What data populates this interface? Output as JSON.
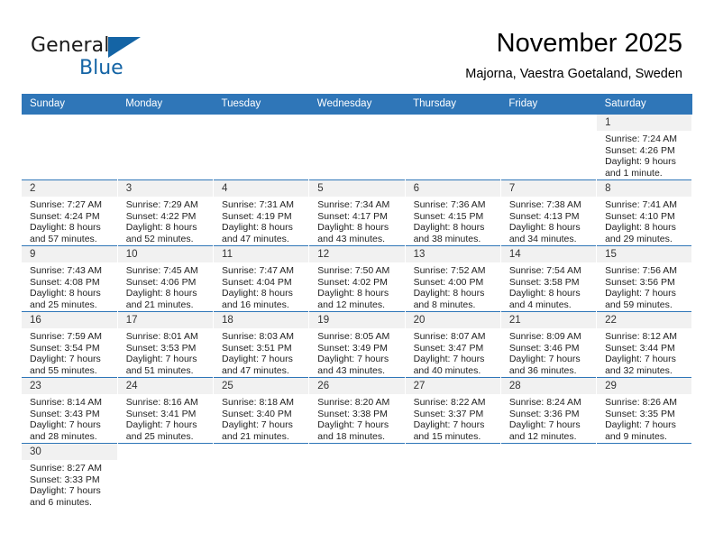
{
  "brand": {
    "name_part1": "General",
    "name_part2": "Blue",
    "flag_icon": "blue-triangle-flag",
    "accent_color": "#1464a5"
  },
  "header": {
    "month_title": "November 2025",
    "location": "Majorna, Vaestra Goetaland, Sweden"
  },
  "theme": {
    "header_row_bg": "#2f76b8",
    "daynum_band_bg": "#f1f1f1",
    "week_separator": "#2f76b8",
    "text": "#222222"
  },
  "calendar": {
    "weekday_headers": [
      "Sunday",
      "Monday",
      "Tuesday",
      "Wednesday",
      "Thursday",
      "Friday",
      "Saturday"
    ],
    "weeks": [
      [
        {
          "day": "",
          "lines": []
        },
        {
          "day": "",
          "lines": []
        },
        {
          "day": "",
          "lines": []
        },
        {
          "day": "",
          "lines": []
        },
        {
          "day": "",
          "lines": []
        },
        {
          "day": "",
          "lines": []
        },
        {
          "day": "1",
          "lines": [
            "Sunrise: 7:24 AM",
            "Sunset: 4:26 PM",
            "Daylight: 9 hours",
            "and 1 minute."
          ]
        }
      ],
      [
        {
          "day": "2",
          "lines": [
            "Sunrise: 7:27 AM",
            "Sunset: 4:24 PM",
            "Daylight: 8 hours",
            "and 57 minutes."
          ]
        },
        {
          "day": "3",
          "lines": [
            "Sunrise: 7:29 AM",
            "Sunset: 4:22 PM",
            "Daylight: 8 hours",
            "and 52 minutes."
          ]
        },
        {
          "day": "4",
          "lines": [
            "Sunrise: 7:31 AM",
            "Sunset: 4:19 PM",
            "Daylight: 8 hours",
            "and 47 minutes."
          ]
        },
        {
          "day": "5",
          "lines": [
            "Sunrise: 7:34 AM",
            "Sunset: 4:17 PM",
            "Daylight: 8 hours",
            "and 43 minutes."
          ]
        },
        {
          "day": "6",
          "lines": [
            "Sunrise: 7:36 AM",
            "Sunset: 4:15 PM",
            "Daylight: 8 hours",
            "and 38 minutes."
          ]
        },
        {
          "day": "7",
          "lines": [
            "Sunrise: 7:38 AM",
            "Sunset: 4:13 PM",
            "Daylight: 8 hours",
            "and 34 minutes."
          ]
        },
        {
          "day": "8",
          "lines": [
            "Sunrise: 7:41 AM",
            "Sunset: 4:10 PM",
            "Daylight: 8 hours",
            "and 29 minutes."
          ]
        }
      ],
      [
        {
          "day": "9",
          "lines": [
            "Sunrise: 7:43 AM",
            "Sunset: 4:08 PM",
            "Daylight: 8 hours",
            "and 25 minutes."
          ]
        },
        {
          "day": "10",
          "lines": [
            "Sunrise: 7:45 AM",
            "Sunset: 4:06 PM",
            "Daylight: 8 hours",
            "and 21 minutes."
          ]
        },
        {
          "day": "11",
          "lines": [
            "Sunrise: 7:47 AM",
            "Sunset: 4:04 PM",
            "Daylight: 8 hours",
            "and 16 minutes."
          ]
        },
        {
          "day": "12",
          "lines": [
            "Sunrise: 7:50 AM",
            "Sunset: 4:02 PM",
            "Daylight: 8 hours",
            "and 12 minutes."
          ]
        },
        {
          "day": "13",
          "lines": [
            "Sunrise: 7:52 AM",
            "Sunset: 4:00 PM",
            "Daylight: 8 hours",
            "and 8 minutes."
          ]
        },
        {
          "day": "14",
          "lines": [
            "Sunrise: 7:54 AM",
            "Sunset: 3:58 PM",
            "Daylight: 8 hours",
            "and 4 minutes."
          ]
        },
        {
          "day": "15",
          "lines": [
            "Sunrise: 7:56 AM",
            "Sunset: 3:56 PM",
            "Daylight: 7 hours",
            "and 59 minutes."
          ]
        }
      ],
      [
        {
          "day": "16",
          "lines": [
            "Sunrise: 7:59 AM",
            "Sunset: 3:54 PM",
            "Daylight: 7 hours",
            "and 55 minutes."
          ]
        },
        {
          "day": "17",
          "lines": [
            "Sunrise: 8:01 AM",
            "Sunset: 3:53 PM",
            "Daylight: 7 hours",
            "and 51 minutes."
          ]
        },
        {
          "day": "18",
          "lines": [
            "Sunrise: 8:03 AM",
            "Sunset: 3:51 PM",
            "Daylight: 7 hours",
            "and 47 minutes."
          ]
        },
        {
          "day": "19",
          "lines": [
            "Sunrise: 8:05 AM",
            "Sunset: 3:49 PM",
            "Daylight: 7 hours",
            "and 43 minutes."
          ]
        },
        {
          "day": "20",
          "lines": [
            "Sunrise: 8:07 AM",
            "Sunset: 3:47 PM",
            "Daylight: 7 hours",
            "and 40 minutes."
          ]
        },
        {
          "day": "21",
          "lines": [
            "Sunrise: 8:09 AM",
            "Sunset: 3:46 PM",
            "Daylight: 7 hours",
            "and 36 minutes."
          ]
        },
        {
          "day": "22",
          "lines": [
            "Sunrise: 8:12 AM",
            "Sunset: 3:44 PM",
            "Daylight: 7 hours",
            "and 32 minutes."
          ]
        }
      ],
      [
        {
          "day": "23",
          "lines": [
            "Sunrise: 8:14 AM",
            "Sunset: 3:43 PM",
            "Daylight: 7 hours",
            "and 28 minutes."
          ]
        },
        {
          "day": "24",
          "lines": [
            "Sunrise: 8:16 AM",
            "Sunset: 3:41 PM",
            "Daylight: 7 hours",
            "and 25 minutes."
          ]
        },
        {
          "day": "25",
          "lines": [
            "Sunrise: 8:18 AM",
            "Sunset: 3:40 PM",
            "Daylight: 7 hours",
            "and 21 minutes."
          ]
        },
        {
          "day": "26",
          "lines": [
            "Sunrise: 8:20 AM",
            "Sunset: 3:38 PM",
            "Daylight: 7 hours",
            "and 18 minutes."
          ]
        },
        {
          "day": "27",
          "lines": [
            "Sunrise: 8:22 AM",
            "Sunset: 3:37 PM",
            "Daylight: 7 hours",
            "and 15 minutes."
          ]
        },
        {
          "day": "28",
          "lines": [
            "Sunrise: 8:24 AM",
            "Sunset: 3:36 PM",
            "Daylight: 7 hours",
            "and 12 minutes."
          ]
        },
        {
          "day": "29",
          "lines": [
            "Sunrise: 8:26 AM",
            "Sunset: 3:35 PM",
            "Daylight: 7 hours",
            "and 9 minutes."
          ]
        }
      ],
      [
        {
          "day": "30",
          "lines": [
            "Sunrise: 8:27 AM",
            "Sunset: 3:33 PM",
            "Daylight: 7 hours",
            "and 6 minutes."
          ]
        },
        {
          "day": "",
          "lines": []
        },
        {
          "day": "",
          "lines": []
        },
        {
          "day": "",
          "lines": []
        },
        {
          "day": "",
          "lines": []
        },
        {
          "day": "",
          "lines": []
        },
        {
          "day": "",
          "lines": []
        }
      ]
    ]
  }
}
